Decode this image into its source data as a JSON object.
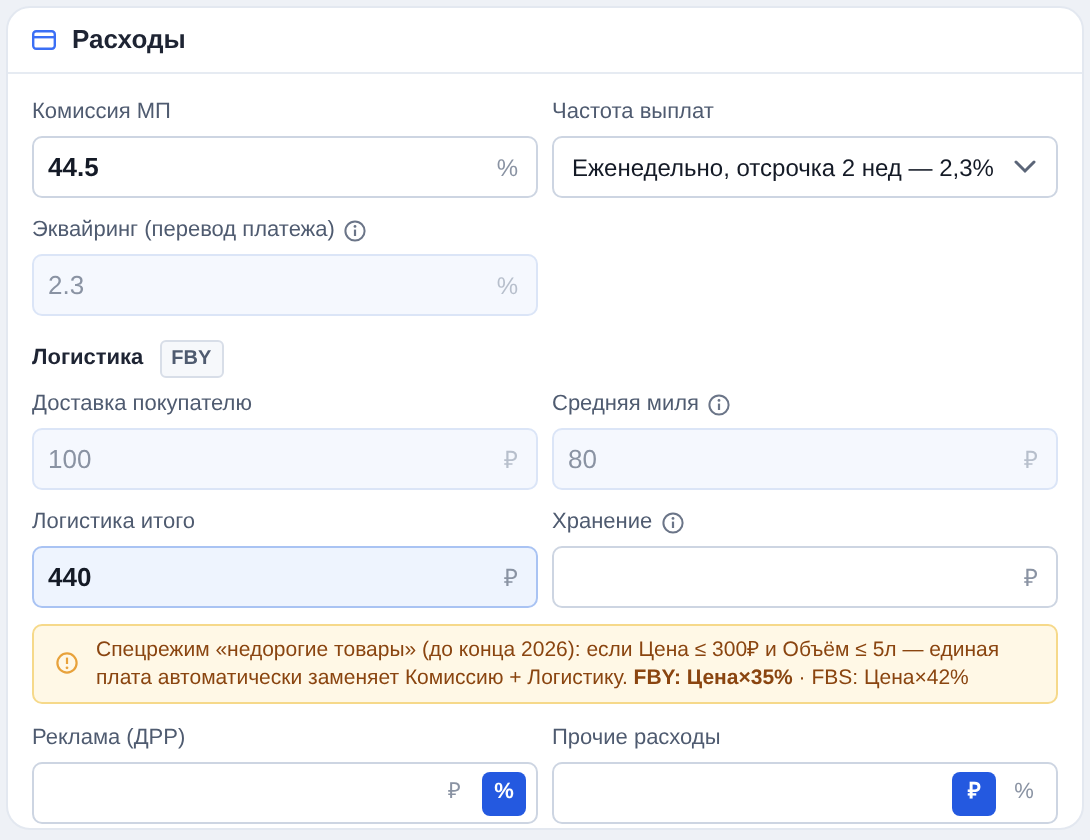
{
  "card": {
    "title": "Расходы"
  },
  "sections": [
    {
      "kind": "fields",
      "fields": [
        {
          "label": "Комиссия МП",
          "info": false,
          "kind": "input",
          "value": "44.5",
          "unit": "%",
          "disabled": false,
          "highlighted": false
        },
        {
          "label": "Частота выплат",
          "info": false,
          "kind": "select",
          "value": "Еженедельно, отсрочка 2 нед — 2,3%",
          "disabled": false,
          "highlighted": false
        },
        {
          "label": "Эквайринг (перевод платежа)",
          "info": true,
          "kind": "input",
          "value": "2.3",
          "unit": "%",
          "disabled": true,
          "highlighted": false
        }
      ]
    },
    {
      "kind": "heading",
      "title": "Логистика",
      "badge": "FBY"
    },
    {
      "kind": "fields",
      "fields": [
        {
          "label": "Доставка покупателю",
          "info": false,
          "kind": "input",
          "value": "100",
          "unit": "₽",
          "disabled": true,
          "highlighted": false
        },
        {
          "label": "Средняя миля",
          "info": true,
          "kind": "input",
          "value": "80",
          "unit": "₽",
          "disabled": true,
          "highlighted": false
        },
        {
          "label": "Логистика итого",
          "info": false,
          "kind": "input",
          "value": "440",
          "unit": "₽",
          "disabled": false,
          "highlighted": true
        },
        {
          "label": "Хранение",
          "info": true,
          "kind": "input",
          "unit": "₽",
          "disabled": false,
          "highlighted": false
        }
      ]
    },
    {
      "kind": "notice",
      "text": "Спецрежим «недорогие товары» (до конца 2026): если Цена ≤ 300₽ и Объём ≤ 5л — единая плата автоматически заменяет Комиссию + Логистику. **FBY: Цена×35%** · FBS: Цена×42%"
    },
    {
      "kind": "fields",
      "fields": [
        {
          "label": "Реклама (ДРР)",
          "info": false,
          "kind": "toggle",
          "disabled": false,
          "highlighted": false,
          "options": [
            {
              "label": "₽",
              "selected": false
            },
            {
              "label": "%",
              "selected": true
            }
          ]
        },
        {
          "label": "Прочие расходы",
          "info": false,
          "kind": "toggle",
          "disabled": false,
          "highlighted": false,
          "options": [
            {
              "label": "₽",
              "selected": true
            },
            {
              "label": "%",
              "selected": false
            }
          ]
        }
      ]
    }
  ]
}
